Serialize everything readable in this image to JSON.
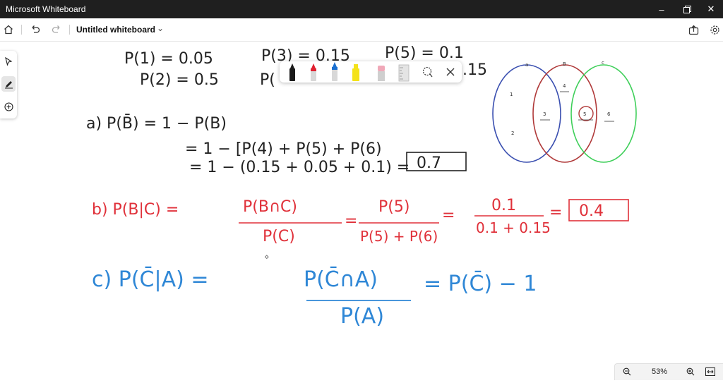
{
  "window": {
    "app_title": "Microsoft Whiteboard",
    "controls": [
      "minimize",
      "restore",
      "close"
    ]
  },
  "toolbar": {
    "board_title": "Untitled whiteboard",
    "icons": [
      "home-icon",
      "undo-icon",
      "redo-icon",
      "chevron-down-icon",
      "share-icon",
      "settings-icon"
    ]
  },
  "left_rail": {
    "tools": [
      "select-icon",
      "inking-icon",
      "add-icon"
    ],
    "active": "inking"
  },
  "ink_tray": {
    "tools": [
      "black-pen",
      "red-pen",
      "blue-pen",
      "yellow-highlighter",
      "pink-eraser",
      "ruler",
      "lasso-select",
      "close"
    ],
    "colors": {
      "black": "#1a1a1a",
      "red": "#e02030",
      "blue": "#1a6fd0",
      "yellow": "#f4e21a",
      "pink": "#f0a8b8"
    }
  },
  "whiteboard": {
    "ink_color_black": "#222222",
    "ink_color_red": "#e0313a",
    "ink_color_blue": "#2f87d6",
    "given": {
      "p1": "P(1) = 0.05",
      "p2": "P(2) = 0.5",
      "p3": "P(3) = 0.15",
      "p4": "P(",
      "p5": "P(5) = 0.1",
      "p6": ".15"
    },
    "part_a": {
      "line1": "a) P(B̄) = 1 − P(B)",
      "line2": "= 1 − [P(4) + P(5) + P(6)",
      "line3": "= 1 − (0.15 + 0.05 + 0.1) =",
      "answer": "0.7"
    },
    "part_b": {
      "lhs": "b) P(B|C) =",
      "frac1_num": "P(B∩C)",
      "frac1_den": "P(C)",
      "frac2_num": "P(5)",
      "frac2_den": "P(5) + P(6)",
      "frac3_num": "0.1",
      "frac3_den": "0.1 + 0.15",
      "answer": "0.4"
    },
    "part_c": {
      "lhs": "c) P(C̄|A) =",
      "frac_num": "P(C̄∩A)",
      "frac_den": "P(A)",
      "rhs": "= P(C̄) − 1"
    },
    "venn": {
      "set_labels": [
        "a",
        "B",
        "c"
      ],
      "regions": [
        "1",
        "2",
        "3",
        "4",
        "5",
        "6"
      ],
      "colors": {
        "A": "#3a4fb0",
        "B": "#b03a3a",
        "C": "#3fcf5a"
      }
    }
  },
  "zoom": {
    "level": "53%",
    "icons": [
      "zoom-out-icon",
      "zoom-in-icon",
      "fit-to-screen-icon"
    ]
  }
}
